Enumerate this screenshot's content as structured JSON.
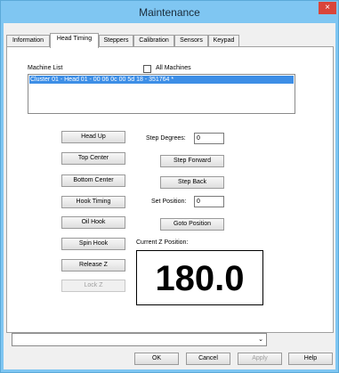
{
  "window": {
    "title": "Maintenance",
    "close_glyph": "×"
  },
  "tabs": [
    {
      "label": "Information"
    },
    {
      "label": "Head Timing"
    },
    {
      "label": "Steppers"
    },
    {
      "label": "Calibration"
    },
    {
      "label": "Sensors"
    },
    {
      "label": "Keypad"
    }
  ],
  "active_tab": "Head Timing",
  "machine_list": {
    "label": "Machine List",
    "all_machines_label": "All Machines",
    "all_machines_checked": false,
    "items": [
      "Cluster 01 - Head 01 - 00 06 0c 00 5d 18 - 351764 *"
    ]
  },
  "left_buttons": {
    "head_up": "Head Up",
    "top_center": "Top Center",
    "bottom_center": "Bottom Center",
    "hook_timing": "Hook Timing",
    "oil_hook": "Oil Hook",
    "spin_hook": "Spin Hook",
    "release_z": "Release Z",
    "lock_z": "Lock Z"
  },
  "right_controls": {
    "step_degrees_label": "Step Degrees:",
    "step_degrees_value": "0",
    "step_forward": "Step Forward",
    "step_back": "Step Back",
    "set_position_label": "Set Position:",
    "set_position_value": "0",
    "goto_position": "Goto Position",
    "current_z_label": "Current Z Position:",
    "current_z_value": "180.0"
  },
  "dropdown": {
    "value": "",
    "arrow": "⌄"
  },
  "footer": {
    "ok": "OK",
    "cancel": "Cancel",
    "apply": "Apply",
    "help": "Help"
  }
}
